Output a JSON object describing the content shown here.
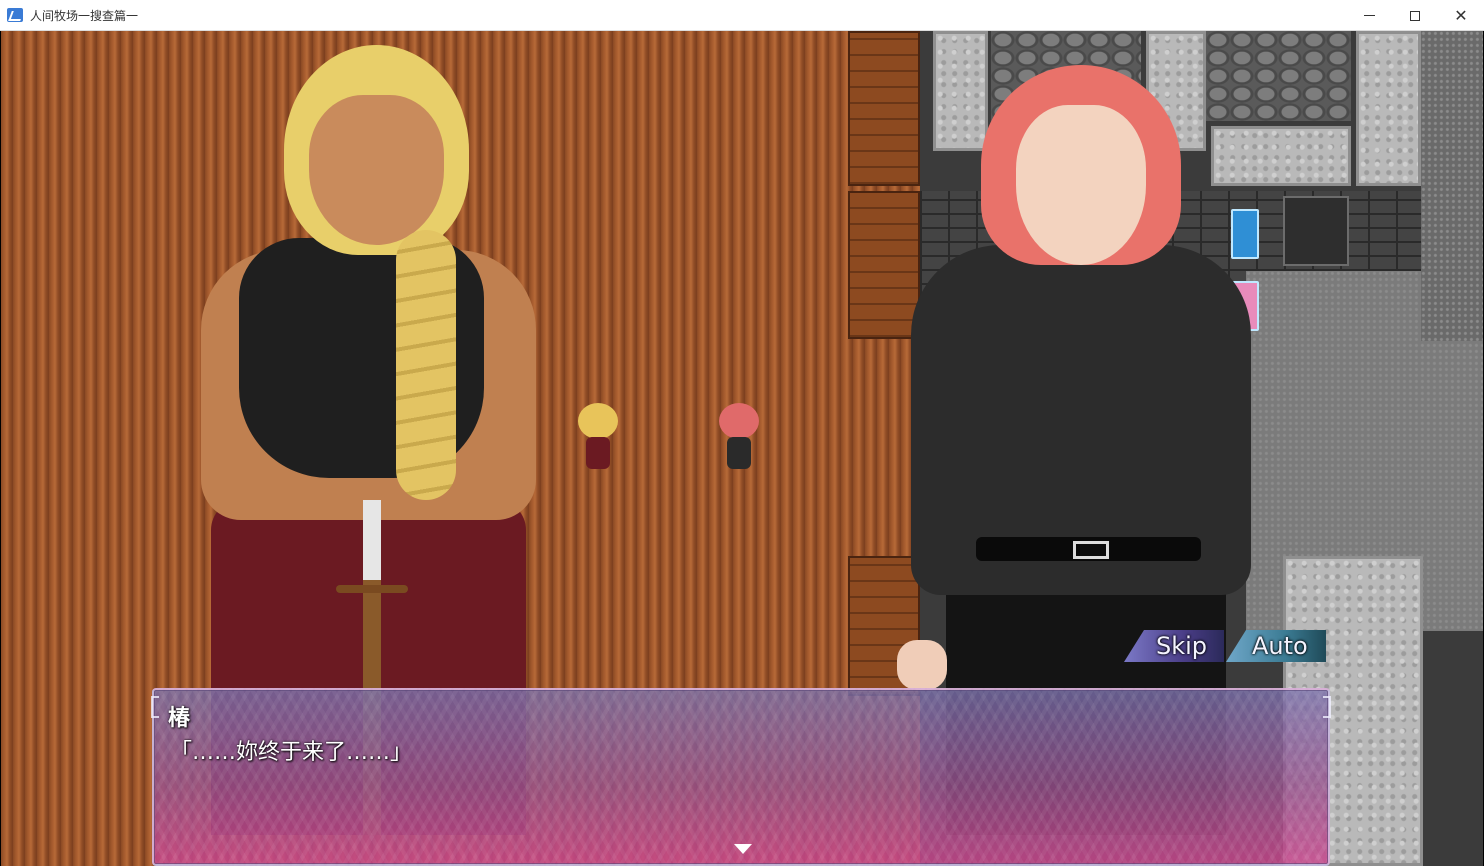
{
  "window": {
    "title": "人间牧场一搜查篇一",
    "minimize_glyph": "",
    "maximize_glyph": "",
    "close_glyph": "✕"
  },
  "icons": {
    "app": "app-icon",
    "advance": "triangle-down-icon"
  },
  "controls": {
    "skip_label": "Skip",
    "auto_label": "Auto"
  },
  "dialogue": {
    "speaker": "椿",
    "text": "「……妳终于来了……」"
  },
  "colors": {
    "message_top": "#786ea6",
    "message_bottom": "#c8468c",
    "skip_button": "#4a3d87",
    "auto_button": "#3b7b93"
  }
}
